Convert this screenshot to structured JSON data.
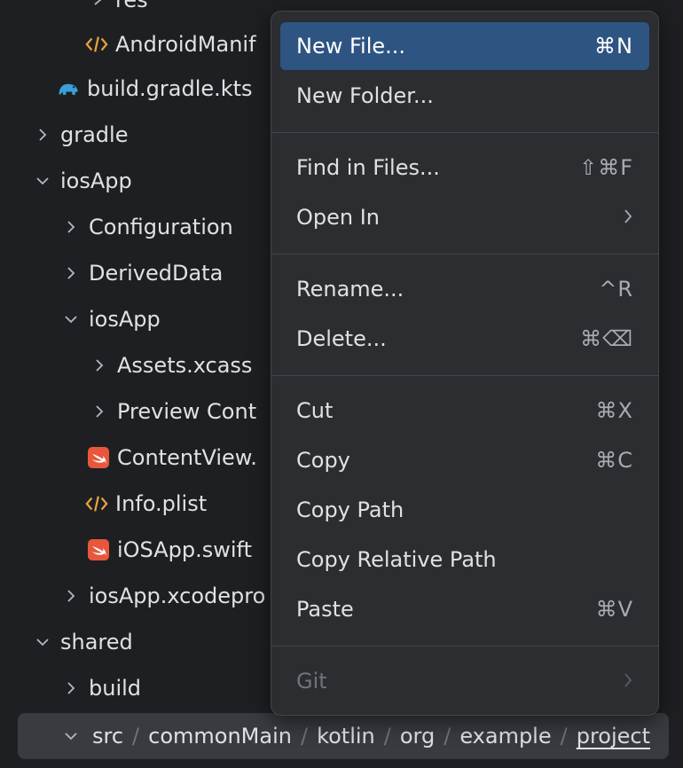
{
  "tree": {
    "rows": [
      {
        "label": "res"
      },
      {
        "label": "AndroidManif"
      },
      {
        "label": "build.gradle.kts"
      },
      {
        "label": "gradle"
      },
      {
        "label": "iosApp"
      },
      {
        "label": "Configuration"
      },
      {
        "label": "DerivedData"
      },
      {
        "label": "iosApp"
      },
      {
        "label": "Assets.xcass"
      },
      {
        "label": "Preview Cont"
      },
      {
        "label": "ContentView."
      },
      {
        "label": "Info.plist"
      },
      {
        "label": "iOSApp.swift"
      },
      {
        "label": "iosApp.xcodepro"
      },
      {
        "label": "shared"
      },
      {
        "label": "build"
      }
    ],
    "breadcrumb": [
      "src",
      "commonMain",
      "kotlin",
      "org",
      "example",
      "project"
    ],
    "breadcrumb_separator": "/"
  },
  "menu": {
    "items": [
      {
        "label": "New File...",
        "shortcut": "⌘N"
      },
      {
        "label": "New Folder...",
        "shortcut": ""
      },
      {
        "label": "Find in Files...",
        "shortcut": "⇧⌘F"
      },
      {
        "label": "Open In",
        "shortcut": ""
      },
      {
        "label": "Rename...",
        "shortcut": "^R"
      },
      {
        "label": "Delete...",
        "shortcut": "⌘⌫"
      },
      {
        "label": "Cut",
        "shortcut": "⌘X"
      },
      {
        "label": "Copy",
        "shortcut": "⌘C"
      },
      {
        "label": "Copy Path",
        "shortcut": ""
      },
      {
        "label": "Copy Relative Path",
        "shortcut": ""
      },
      {
        "label": "Paste",
        "shortcut": "⌘V"
      },
      {
        "label": "Git",
        "shortcut": ""
      }
    ]
  },
  "colors": {
    "background": "#1e1f22",
    "menu_background": "#2b2d30",
    "selection": "#2e5482",
    "swift_icon": "#e8573b",
    "xml_icon": "#e8a33c",
    "gradle_icon": "#3aa0d8"
  }
}
